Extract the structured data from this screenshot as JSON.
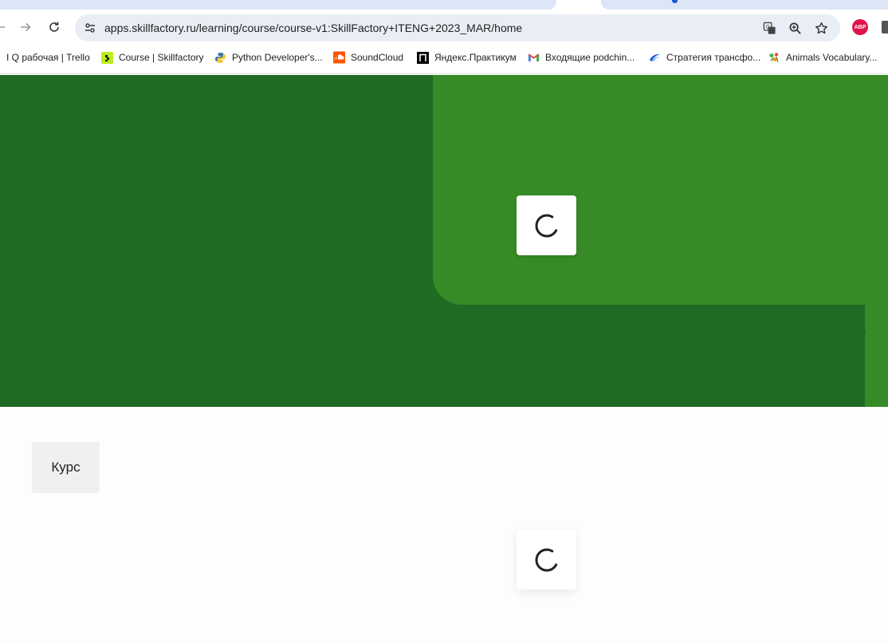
{
  "browser": {
    "tabs": [
      {
        "label": "",
        "state": "inactive"
      },
      {
        "label": "",
        "state": "inactive",
        "has_indicator": true
      }
    ],
    "nav": {
      "back_icon": "back-arrow-icon",
      "forward_icon": "forward-arrow-icon",
      "reload_icon": "reload-icon"
    },
    "address_bar": {
      "url": "apps.skillfactory.ru/learning/course/course-v1:SkillFactory+ITENG+2023_MAR/home",
      "site_icon": "site-settings-icon",
      "actions": [
        "translate-icon",
        "zoom-icon",
        "bookmark-star-icon"
      ]
    },
    "extensions": [
      {
        "name": "adblock-plus-icon",
        "label": "ABP",
        "color": "#e0144c"
      }
    ],
    "bookmarks": [
      {
        "label": "I Q рабочая | Trello",
        "icon": "trello-icon"
      },
      {
        "label": "Course | Skillfactory",
        "icon": "skillfactory-icon",
        "color": "#b9ee1c"
      },
      {
        "label": "Python Developer's...",
        "icon": "python-icon"
      },
      {
        "label": "SoundCloud",
        "icon": "soundcloud-icon",
        "color": "#ff5500"
      },
      {
        "label": "Яндекс.Практикум",
        "icon": "praktikum-icon",
        "color": "#000000"
      },
      {
        "label": "Входящие  podchin...",
        "icon": "gmail-icon"
      },
      {
        "label": "Стратегия трансфо...",
        "icon": "strategy-icon",
        "color": "#1a57d6"
      },
      {
        "label": "Animals Vocabulary...",
        "icon": "animals-icon"
      }
    ]
  },
  "page": {
    "hero": {
      "bg_color": "#1f6b23",
      "panel_color": "#378b26",
      "loading": true,
      "loader_icon": "spinner-icon"
    },
    "course_tab": {
      "label": "Курс"
    },
    "content": {
      "loading": true,
      "loader_icon": "spinner-icon"
    }
  }
}
